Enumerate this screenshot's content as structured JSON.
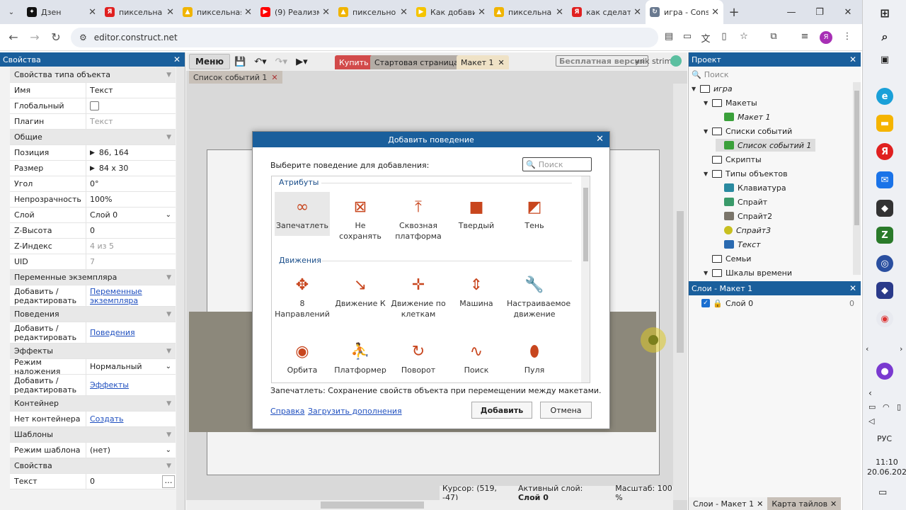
{
  "browser": {
    "tabs": [
      {
        "title": "Дзен",
        "color": "#111111",
        "glyph": "✦"
      },
      {
        "title": "пиксельна",
        "color": "#e02020",
        "glyph": "Я"
      },
      {
        "title": "пиксельная",
        "color": "#f0b400",
        "glyph": "▲"
      },
      {
        "title": "(9) Реализм",
        "color": "#ff0000",
        "glyph": "▶"
      },
      {
        "title": "пиксельно",
        "color": "#f0b400",
        "glyph": "▲"
      },
      {
        "title": "Как добави",
        "color": "#f5c400",
        "glyph": "▶"
      },
      {
        "title": "пиксельна",
        "color": "#f0b400",
        "glyph": "▲"
      },
      {
        "title": "как сделать",
        "color": "#e02020",
        "glyph": "Я"
      },
      {
        "title": "игра - Cons",
        "color": "#6a7a90",
        "glyph": "↻",
        "active": true
      }
    ],
    "new_tab": "+",
    "url": "editor.construct.net"
  },
  "properties": {
    "title": "Свойства",
    "rows": [
      {
        "k": "Свойства типа объекта",
        "cat": true
      },
      {
        "k": "Имя",
        "v": "Текст"
      },
      {
        "k": "Глобальный",
        "checkbox": true
      },
      {
        "k": "Плагин",
        "v": "Текст",
        "disabled": true
      },
      {
        "k": "Общие",
        "cat": true
      },
      {
        "k": "Позиция",
        "v": "86,  164",
        "expand": true
      },
      {
        "k": "Размер",
        "v": "84 x 30",
        "expand": true
      },
      {
        "k": "Угол",
        "v": "0°"
      },
      {
        "k": "Непрозрачность",
        "v": "100%"
      },
      {
        "k": "Слой",
        "v": "Слой 0",
        "dropdown": true
      },
      {
        "k": "Z-Высота",
        "v": "0"
      },
      {
        "k": "Z-Индекс",
        "v": "4 из 5",
        "disabled": true
      },
      {
        "k": "UID",
        "v": "7",
        "disabled": true
      },
      {
        "k": "Переменные экземпляра",
        "cat": true
      },
      {
        "k": "Добавить / редактировать",
        "v": "Переменные экземпляра",
        "link": true,
        "tall": true
      },
      {
        "k": "Поведения",
        "cat": true
      },
      {
        "k": "Добавить / редактировать",
        "v": "Поведения",
        "link": true,
        "tall": true
      },
      {
        "k": "Эффекты",
        "cat": true
      },
      {
        "k": "Режим наложения",
        "v": "Нормальный",
        "dropdown": true
      },
      {
        "k": "Добавить / редактировать",
        "v": "Эффекты",
        "link": true,
        "tall": true
      },
      {
        "k": "Контейнер",
        "cat": true
      },
      {
        "k": "Нет контейнера",
        "v": "Создать",
        "link": true
      },
      {
        "k": "Шаблоны",
        "cat": true
      },
      {
        "k": "Режим шаблона",
        "v": "(нет)",
        "dropdown": true
      },
      {
        "k": "Свойства",
        "cat": true
      },
      {
        "k": "Текст",
        "v": "0",
        "ellipsis": true
      }
    ]
  },
  "editor": {
    "menu": "Меню",
    "tabs": [
      {
        "label": "Купить",
        "bg": "#d24a4a",
        "fg": "#ffffff"
      },
      {
        "label": "Стартовая страница",
        "bg": "#b3aca5",
        "fg": "#222222"
      },
      {
        "label": "Макет 1",
        "bg": "#efe2c6",
        "fg": "#222222"
      }
    ],
    "free_version": "Бесплатная версия",
    "user": "yrik strim",
    "subtab": "Список событий 1",
    "status": {
      "cursor": "Курсор: (519, -47)",
      "layer_label": "Активный слой:",
      "layer": "Слой 0",
      "zoom": "Масштаб: 100 %"
    }
  },
  "dialog": {
    "title": "Добавить поведение",
    "prompt": "Выберите поведение для добавления:",
    "search_placeholder": "Поиск",
    "categories": [
      {
        "name": "Атрибуты",
        "items": [
          {
            "label": "Запечатлеть",
            "icon": "∞",
            "name": "persist-icon",
            "selected": true
          },
          {
            "label": "Не сохранять",
            "icon": "⊠",
            "name": "no-save-icon"
          },
          {
            "label": "Сквозная платформа",
            "icon": "⤒",
            "name": "jumpthru-icon"
          },
          {
            "label": "Твердый",
            "icon": "■",
            "name": "solid-icon"
          },
          {
            "label": "Тень",
            "icon": "◩",
            "name": "shadow-icon"
          }
        ]
      },
      {
        "name": "Движения",
        "items": [
          {
            "label": "8 Направлений",
            "icon": "✥",
            "name": "eight-direction-icon"
          },
          {
            "label": "Движение К",
            "icon": "↘",
            "name": "move-to-icon"
          },
          {
            "label": "Движение по клеткам",
            "icon": "✛",
            "name": "tile-movement-icon"
          },
          {
            "label": "Машина",
            "icon": "⇕",
            "name": "car-icon"
          },
          {
            "label": "Настраиваемое движение",
            "icon": "🔧",
            "name": "custom-movement-icon"
          },
          {
            "label": "Орбита",
            "icon": "◉",
            "name": "orbit-icon"
          },
          {
            "label": "Платформер",
            "icon": "⛹",
            "name": "platform-icon"
          },
          {
            "label": "Поворот",
            "icon": "↻",
            "name": "rotate-icon"
          },
          {
            "label": "Поиск",
            "icon": "∿",
            "name": "pathfinding-icon"
          },
          {
            "label": "Пуля",
            "icon": "⬮",
            "name": "bullet-icon"
          }
        ]
      }
    ],
    "description": "Запечатлеть: Сохранение свойств объекта при перемещении между макетами.",
    "help": "Справка",
    "addons": "Загрузить дополнения",
    "add": "Добавить",
    "cancel": "Отмена"
  },
  "project": {
    "title": "Проект",
    "search_placeholder": "Поиск",
    "tree": [
      {
        "label": "игра",
        "depth": 0,
        "type": "folder",
        "italic": true,
        "arrow": true
      },
      {
        "label": "Макеты",
        "depth": 1,
        "type": "folder",
        "arrow": true
      },
      {
        "label": "Макет 1",
        "depth": 2,
        "type": "layout",
        "italic": true
      },
      {
        "label": "Списки событий",
        "depth": 1,
        "type": "folder",
        "arrow": true
      },
      {
        "label": "Список событий 1",
        "depth": 2,
        "type": "events",
        "italic": true,
        "selected": true
      },
      {
        "label": "Скрипты",
        "depth": 1,
        "type": "folder"
      },
      {
        "label": "Типы объектов",
        "depth": 1,
        "type": "folder",
        "arrow": true
      },
      {
        "label": "Клавиатура",
        "depth": 2,
        "type": "keyboard"
      },
      {
        "label": "Спрайт",
        "depth": 2,
        "type": "sprite"
      },
      {
        "label": "Спрайт2",
        "depth": 2,
        "type": "sprite2"
      },
      {
        "label": "Спрайт3",
        "depth": 2,
        "type": "sprite3",
        "italic": true
      },
      {
        "label": "Текст",
        "depth": 2,
        "type": "text",
        "italic": true
      },
      {
        "label": "Семьи",
        "depth": 1,
        "type": "folder"
      },
      {
        "label": "Шкалы времени",
        "depth": 1,
        "type": "folder",
        "arrow": true
      }
    ],
    "layers_title": "Слои - Макет 1",
    "layer": "Слой 0",
    "layer_count": "0",
    "bottom_tabs": [
      "Слои - Макет 1",
      "Карта тайлов"
    ]
  },
  "taskbar": {
    "lang": "РУС",
    "time": "11:10",
    "date": "20.06.2024"
  }
}
